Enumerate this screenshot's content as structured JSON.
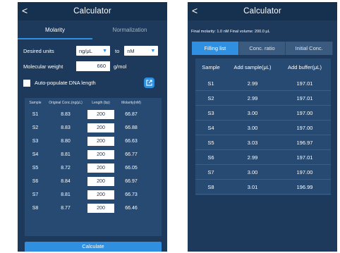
{
  "left": {
    "title": "Calculator",
    "back": "<",
    "tabs": [
      "Molarity",
      "Normalization"
    ],
    "desired_units_label": "Desired units",
    "unit_from": "ng/μL",
    "to_label": "to",
    "unit_to": "nM",
    "mw_label": "Molecular weight",
    "mw_value": "660",
    "mw_unit": "g/mol",
    "autopopulate_label": "Auto-populate DNA length",
    "columns": [
      "Sample",
      "Original Conc.(ng/μL)",
      "Length (bp)",
      "Molarity(nM)"
    ],
    "rows": [
      {
        "sample": "S1",
        "conc": "8.83",
        "length": "200",
        "molarity": "66.87"
      },
      {
        "sample": "S2",
        "conc": "8.83",
        "length": "200",
        "molarity": "66.88"
      },
      {
        "sample": "S3",
        "conc": "8.80",
        "length": "200",
        "molarity": "66.63"
      },
      {
        "sample": "S4",
        "conc": "8.81",
        "length": "200",
        "molarity": "66.77"
      },
      {
        "sample": "S5",
        "conc": "8.72",
        "length": "200",
        "molarity": "66.05"
      },
      {
        "sample": "S6",
        "conc": "8.84",
        "length": "200",
        "molarity": "66.97"
      },
      {
        "sample": "S7",
        "conc": "8.81",
        "length": "200",
        "molarity": "66.73"
      },
      {
        "sample": "S8",
        "conc": "8.77",
        "length": "200",
        "molarity": "66.46"
      }
    ],
    "calculate": "Calculate"
  },
  "right": {
    "title": "Calculator",
    "back": "<",
    "info": "Final molarity: 1.0 nM  Final volume: 200.0 μL",
    "tabs": [
      "Filling list",
      "Conc. ratio",
      "Initial Conc."
    ],
    "columns": [
      "Sample",
      "Add sample(μL)",
      "Add buffer(μL)"
    ],
    "rows": [
      {
        "sample": "S1",
        "add_sample": "2.99",
        "add_buffer": "197.01"
      },
      {
        "sample": "S2",
        "add_sample": "2.99",
        "add_buffer": "197.01"
      },
      {
        "sample": "S3",
        "add_sample": "3.00",
        "add_buffer": "197.00"
      },
      {
        "sample": "S4",
        "add_sample": "3.00",
        "add_buffer": "197.00"
      },
      {
        "sample": "S5",
        "add_sample": "3.03",
        "add_buffer": "196.97"
      },
      {
        "sample": "S6",
        "add_sample": "2.99",
        "add_buffer": "197.01"
      },
      {
        "sample": "S7",
        "add_sample": "3.00",
        "add_buffer": "197.00"
      },
      {
        "sample": "S8",
        "add_sample": "3.01",
        "add_buffer": "196.99"
      }
    ]
  },
  "colors": {
    "background": "#1d3a5c",
    "titlebar": "#16304f",
    "accent": "#2f8fe0",
    "table": "#274a72"
  },
  "icons": [
    "back-icon",
    "dropdown-arrow-icon",
    "external-link-icon",
    "checkbox"
  ]
}
